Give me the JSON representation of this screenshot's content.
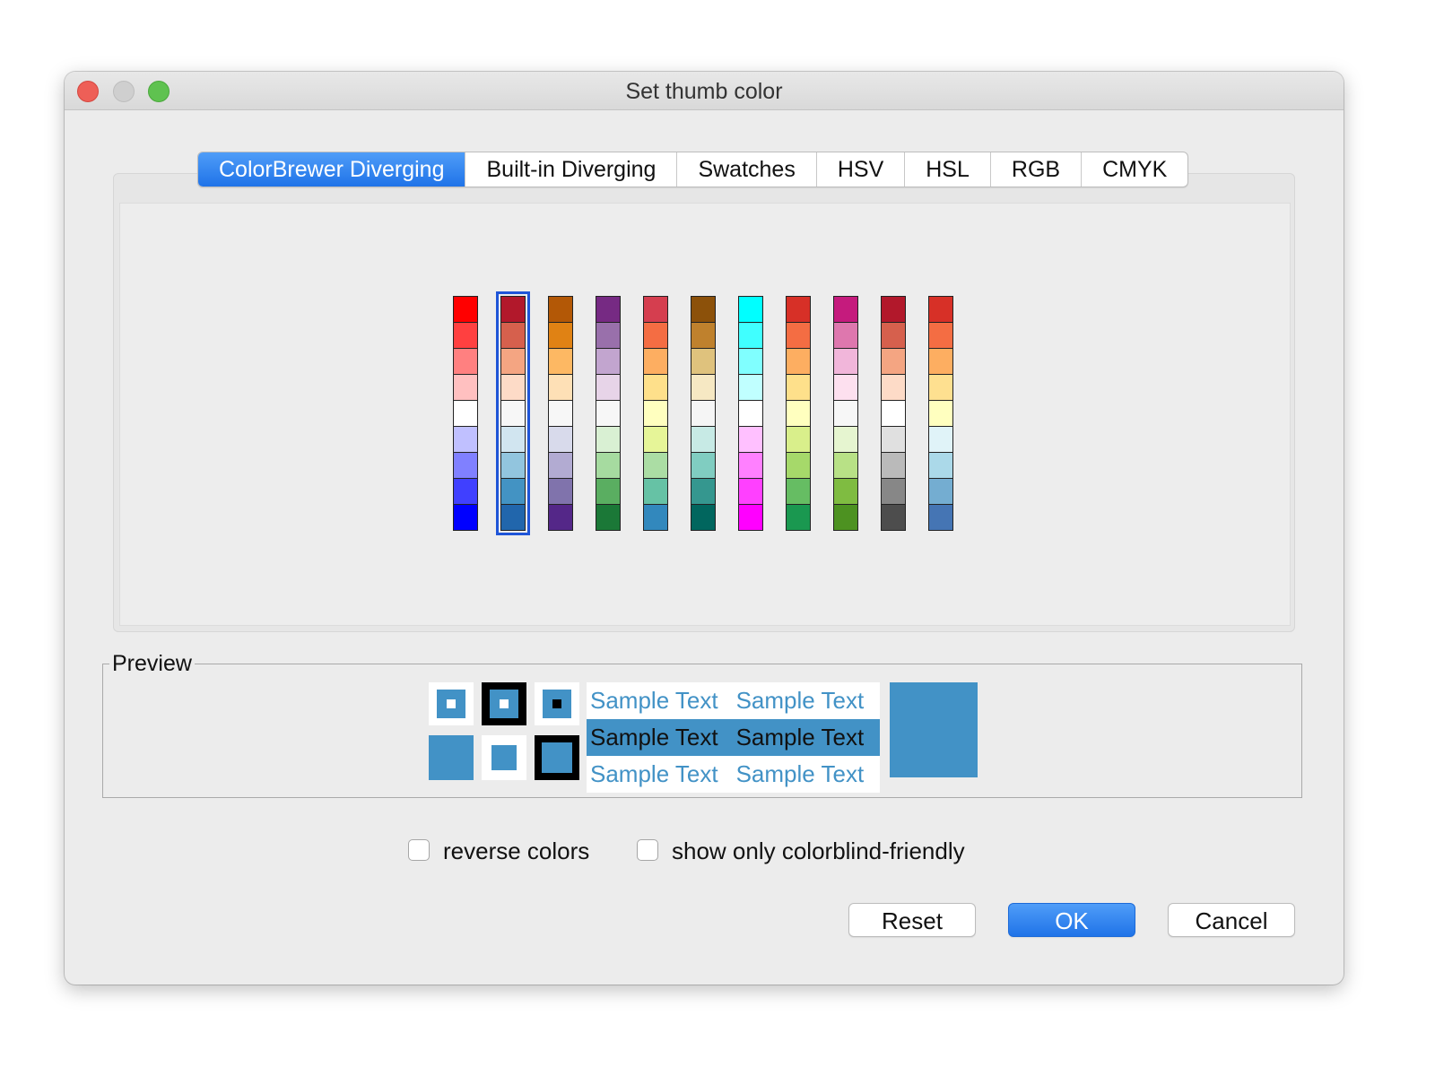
{
  "window": {
    "title": "Set thumb color"
  },
  "tabs": [
    {
      "label": "ColorBrewer Diverging",
      "active": true
    },
    {
      "label": "Built-in Diverging",
      "active": false
    },
    {
      "label": "Swatches",
      "active": false
    },
    {
      "label": "HSV",
      "active": false
    },
    {
      "label": "HSL",
      "active": false
    },
    {
      "label": "RGB",
      "active": false
    },
    {
      "label": "CMYK",
      "active": false
    }
  ],
  "palettes": {
    "selected_index": 1,
    "columns": [
      [
        "#ff0000",
        "#ff4040",
        "#ff8080",
        "#ffc0c0",
        "#ffffff",
        "#c0c0ff",
        "#8080ff",
        "#4040ff",
        "#0000ff"
      ],
      [
        "#b2182b",
        "#d6604d",
        "#f4a582",
        "#fddbc7",
        "#f7f7f7",
        "#d1e5f0",
        "#92c5de",
        "#4393c3",
        "#2166ac"
      ],
      [
        "#b35806",
        "#e08214",
        "#fdb863",
        "#fee0b6",
        "#f7f7f7",
        "#d8daeb",
        "#b2abd2",
        "#8073ac",
        "#542788"
      ],
      [
        "#762a83",
        "#9970ab",
        "#c2a5cf",
        "#e7d4e8",
        "#f7f7f7",
        "#d9f0d3",
        "#a6dba0",
        "#5aae61",
        "#1b7837"
      ],
      [
        "#d53e4f",
        "#f46d43",
        "#fdae61",
        "#fee08b",
        "#ffffbf",
        "#e6f598",
        "#abdda4",
        "#66c2a5",
        "#3288bd"
      ],
      [
        "#8c510a",
        "#bf812d",
        "#dfc27d",
        "#f6e8c3",
        "#f5f5f5",
        "#c7eae5",
        "#80cdc1",
        "#35978f",
        "#01665e"
      ],
      [
        "#00ffff",
        "#40ffff",
        "#80ffff",
        "#c0ffff",
        "#ffffff",
        "#ffc0ff",
        "#ff80ff",
        "#ff40ff",
        "#ff00ff"
      ],
      [
        "#d73027",
        "#f46d43",
        "#fdae61",
        "#fee08b",
        "#ffffbf",
        "#d9ef8b",
        "#a6d96a",
        "#66bd63",
        "#1a9850"
      ],
      [
        "#c51b7d",
        "#de77ae",
        "#f1b6da",
        "#fde0ef",
        "#f7f7f7",
        "#e6f5d0",
        "#b8e186",
        "#7fbc41",
        "#4d9221"
      ],
      [
        "#b2182b",
        "#d6604d",
        "#f4a582",
        "#fddbc7",
        "#ffffff",
        "#e0e0e0",
        "#bababa",
        "#878787",
        "#4d4d4d"
      ],
      [
        "#d73027",
        "#f46d43",
        "#fdae61",
        "#fee090",
        "#ffffbf",
        "#e0f3f8",
        "#abd9e9",
        "#74add1",
        "#4575b4"
      ]
    ]
  },
  "preview": {
    "legend": "Preview",
    "color": "#4292c6",
    "sample_rows": [
      {
        "a": "Sample Text",
        "b": "Sample Text"
      },
      {
        "a": "Sample Text",
        "b": "Sample Text"
      },
      {
        "a": "Sample Text",
        "b": "Sample Text"
      }
    ]
  },
  "options": {
    "reverse_label": "reverse colors",
    "reverse_checked": false,
    "colorblind_label": "show only colorblind-friendly",
    "colorblind_checked": false
  },
  "buttons": {
    "reset": "Reset",
    "ok": "OK",
    "cancel": "Cancel"
  }
}
